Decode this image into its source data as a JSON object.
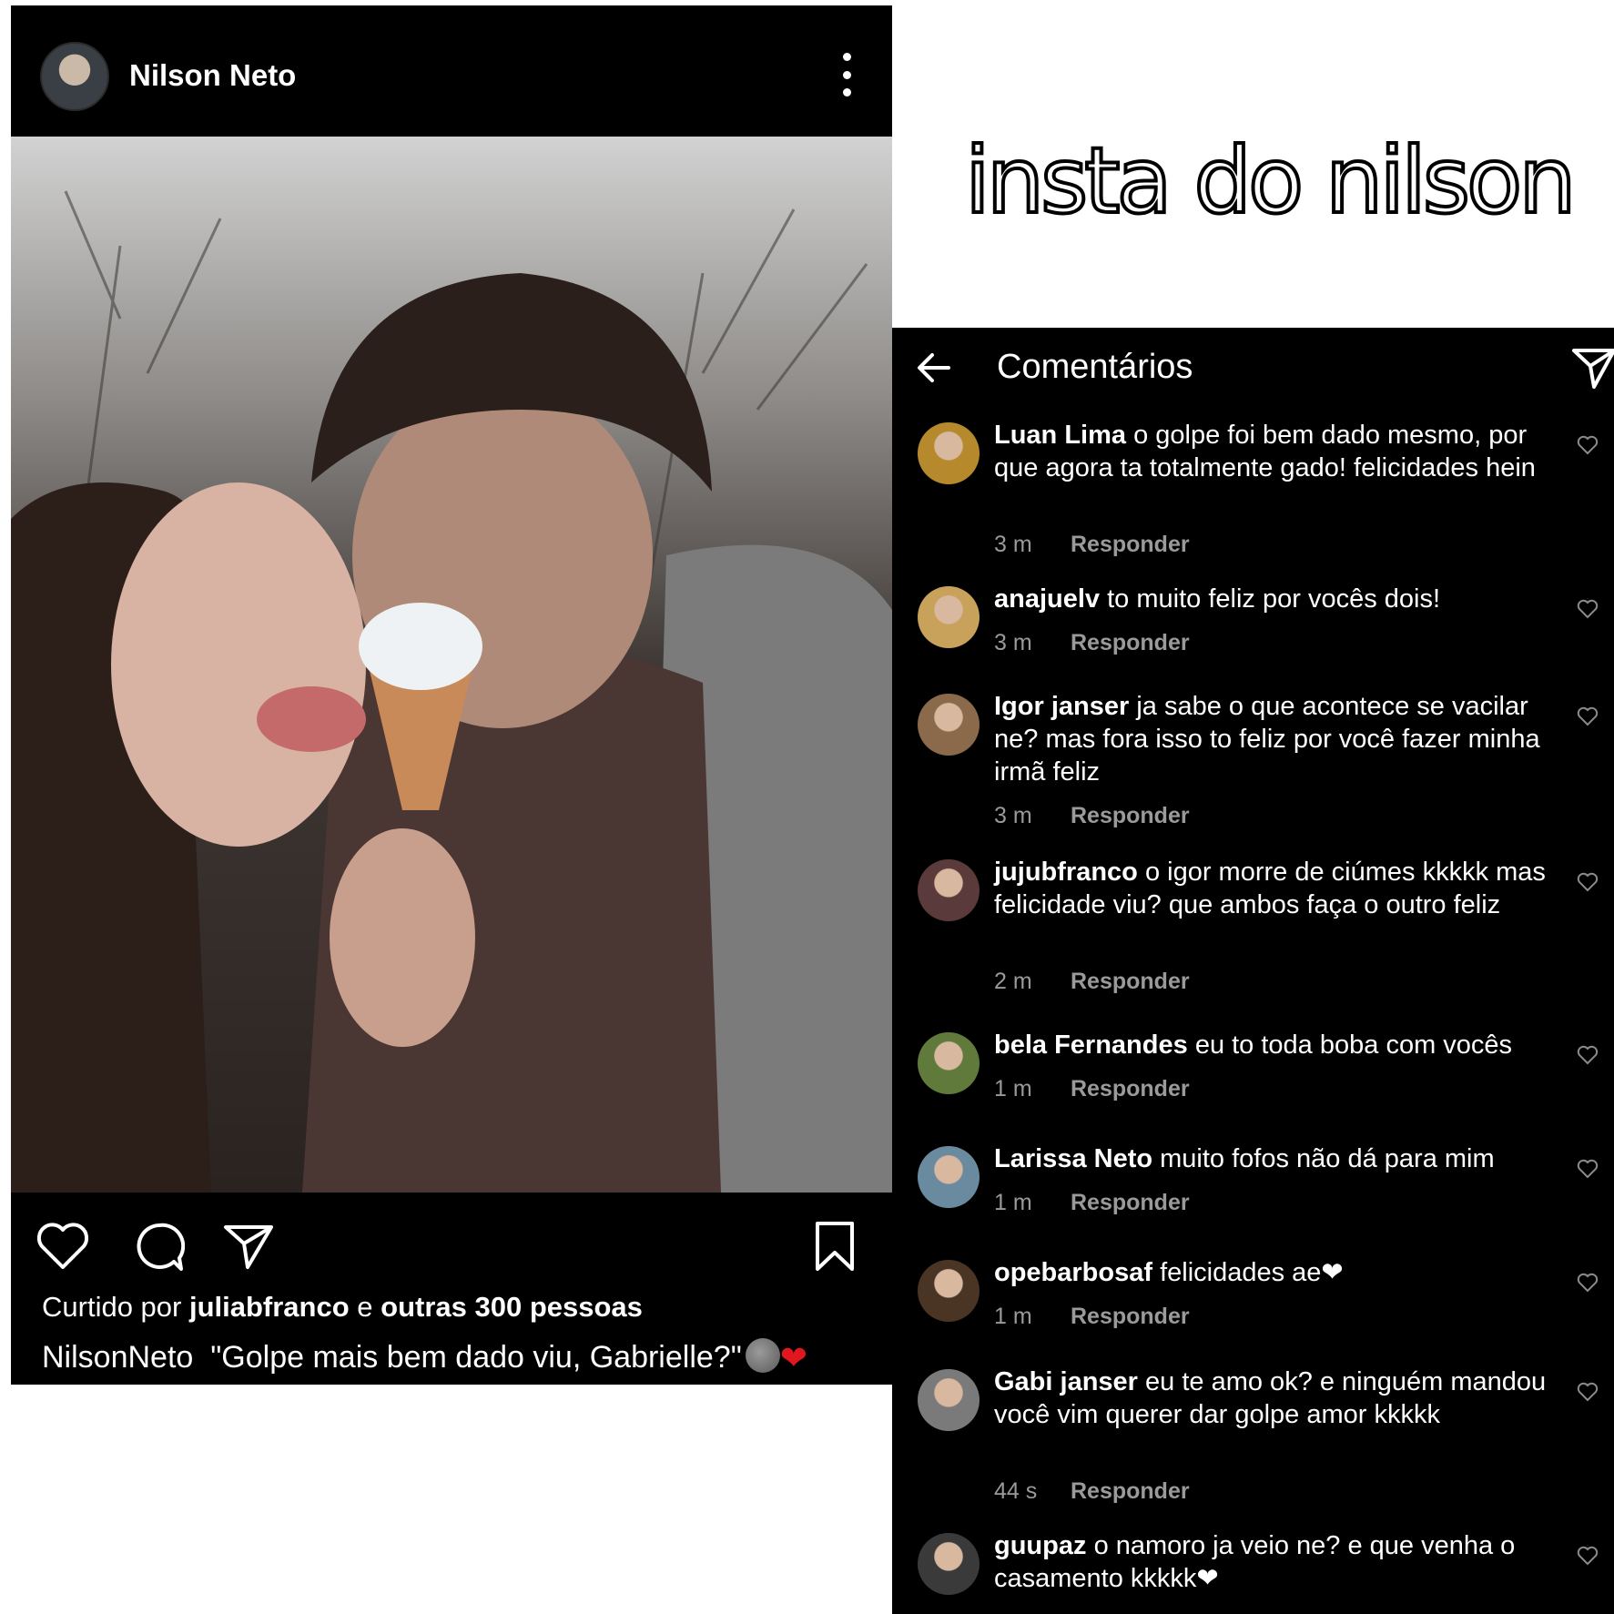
{
  "post": {
    "username": "Nilson Neto",
    "likes_prefix": "Curtido por ",
    "likes_user": "juliabfranco",
    "likes_mid": " e ",
    "likes_others": "outras 300 pessoas",
    "caption_user": "NilsonNeto",
    "caption_text": "\"Golpe mais bem dado viu, Gabrielle?\"",
    "caption_heart": "❤"
  },
  "title": "insta do nilson",
  "comments_panel": {
    "title": "Comentários",
    "reply_label": "Responder",
    "items": [
      {
        "user": "Luan Lima",
        "text": "o golpe foi bem dado mesmo, por que agora ta totalmente gado! felicidades hein",
        "time": "3 m",
        "avatar_color": "#b7892d"
      },
      {
        "user": "anajuelv",
        "text": "to muito feliz por vocês dois!",
        "time": "3 m",
        "avatar_color": "#c8a15a"
      },
      {
        "user": "Igor janser",
        "text": "ja sabe o que acontece se vacilar ne? mas fora isso to feliz por você fazer minha irmã feliz",
        "time": "3 m",
        "avatar_color": "#8a6a4a"
      },
      {
        "user": "jujubfranco",
        "text": "o igor morre de ciúmes kkkkk mas felicidade viu? que ambos faça o outro feliz",
        "time": "2 m",
        "avatar_color": "#5a3a3a"
      },
      {
        "user": "bela Fernandes",
        "text": "eu to toda boba com vocês",
        "time": "1 m",
        "avatar_color": "#5f7a3a"
      },
      {
        "user": "Larissa Neto",
        "text": "muito fofos não dá para mim",
        "time": "1 m",
        "avatar_color": "#6a8aa0"
      },
      {
        "user": "opebarbosaf",
        "text": "felicidades ae❤",
        "time": "1 m",
        "avatar_color": "#4a3424"
      },
      {
        "user": "Gabi janser",
        "text": "eu te amo ok? e ninguém mandou você vim querer dar golpe amor kkkkk",
        "time": "44 s",
        "avatar_color": "#7a7a7a"
      },
      {
        "user": "guupaz",
        "text": "o namoro ja veio ne? e que venha o casamento kkkkk❤",
        "time": "",
        "avatar_color": "#3a3a3a"
      }
    ]
  }
}
